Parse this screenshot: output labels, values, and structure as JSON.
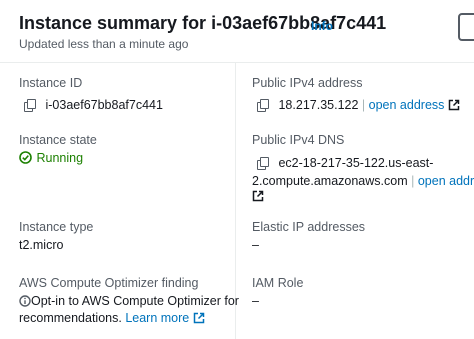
{
  "header": {
    "title": "Instance summary for i-03aef67bb8af7c441",
    "info_label": "Info",
    "updated": "Updated less than a minute ago"
  },
  "left": {
    "instance_id": {
      "label": "Instance ID",
      "value": "i-03aef67bb8af7c441"
    },
    "instance_state": {
      "label": "Instance state",
      "value": "Running",
      "status_color": "#1d8102"
    },
    "instance_type": {
      "label": "Instance type",
      "value": "t2.micro"
    },
    "optimizer": {
      "label": "AWS Compute Optimizer finding",
      "line1": "Opt-in to AWS Compute Optimizer for",
      "line2": "recommendations.",
      "link": "Learn more"
    }
  },
  "right": {
    "public_ipv4": {
      "label": "Public IPv4 address",
      "value": "18.217.35.122",
      "separator": "|",
      "link": "open address"
    },
    "public_dns": {
      "label": "Public IPv4 DNS",
      "line1": "ec2-18-217-35-122.us-east-",
      "line2": "2.compute.amazonaws.com",
      "separator": "|",
      "link": "open address"
    },
    "elastic_ip": {
      "label": "Elastic IP addresses",
      "value": "–"
    },
    "iam_role": {
      "label": "IAM Role",
      "value": "–"
    }
  },
  "colors": {
    "link": "#0073bb",
    "label": "#545b64",
    "text": "#16191f",
    "success": "#1d8102"
  }
}
